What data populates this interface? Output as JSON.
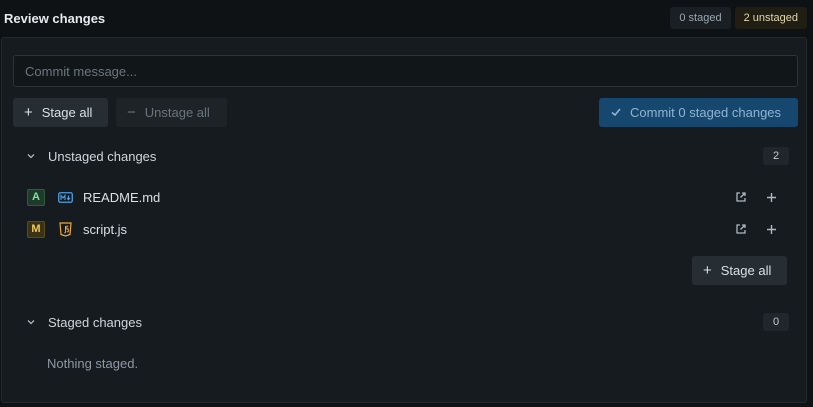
{
  "header": {
    "title": "Review changes",
    "staged_badge": "0 staged",
    "unstaged_badge": "2 unstaged"
  },
  "commit": {
    "placeholder": "Commit message...",
    "value": ""
  },
  "toolbar": {
    "stage_all_label": "Stage all",
    "unstage_all_label": "Unstage all",
    "commit_label": "Commit 0 staged changes"
  },
  "unstaged": {
    "label": "Unstaged changes",
    "count": "2",
    "files": [
      {
        "status": "A",
        "status_kind": "added",
        "icon": "markdown-file-icon",
        "name": "README.md"
      },
      {
        "status": "M",
        "status_kind": "modified",
        "icon": "javascript-file-icon",
        "name": "script.js"
      }
    ],
    "stage_all_label": "Stage all"
  },
  "staged": {
    "label": "Staged changes",
    "count": "0",
    "empty_text": "Nothing staged."
  },
  "colors": {
    "background": "#0f1214",
    "panel": "#161b1f",
    "primary_button": "#16476e",
    "added": "#7fe3a1",
    "modified": "#f0cc5a"
  }
}
